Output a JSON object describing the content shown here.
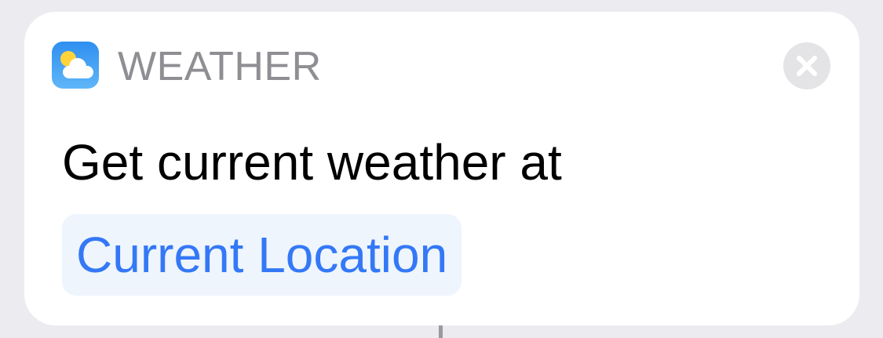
{
  "action": {
    "app_name": "WEATHER",
    "app_icon": "weather-icon",
    "close_icon": "close-icon",
    "description": "Get current weather at",
    "parameter": "Current Location"
  },
  "colors": {
    "background": "#ececf0",
    "card": "#ffffff",
    "app_name": "#8e8e93",
    "parameter_text": "#3478f6",
    "parameter_background": "#eef5fd",
    "icon_gradient_top": "#2f8ff0",
    "icon_gradient_bottom": "#5fb6f8"
  }
}
